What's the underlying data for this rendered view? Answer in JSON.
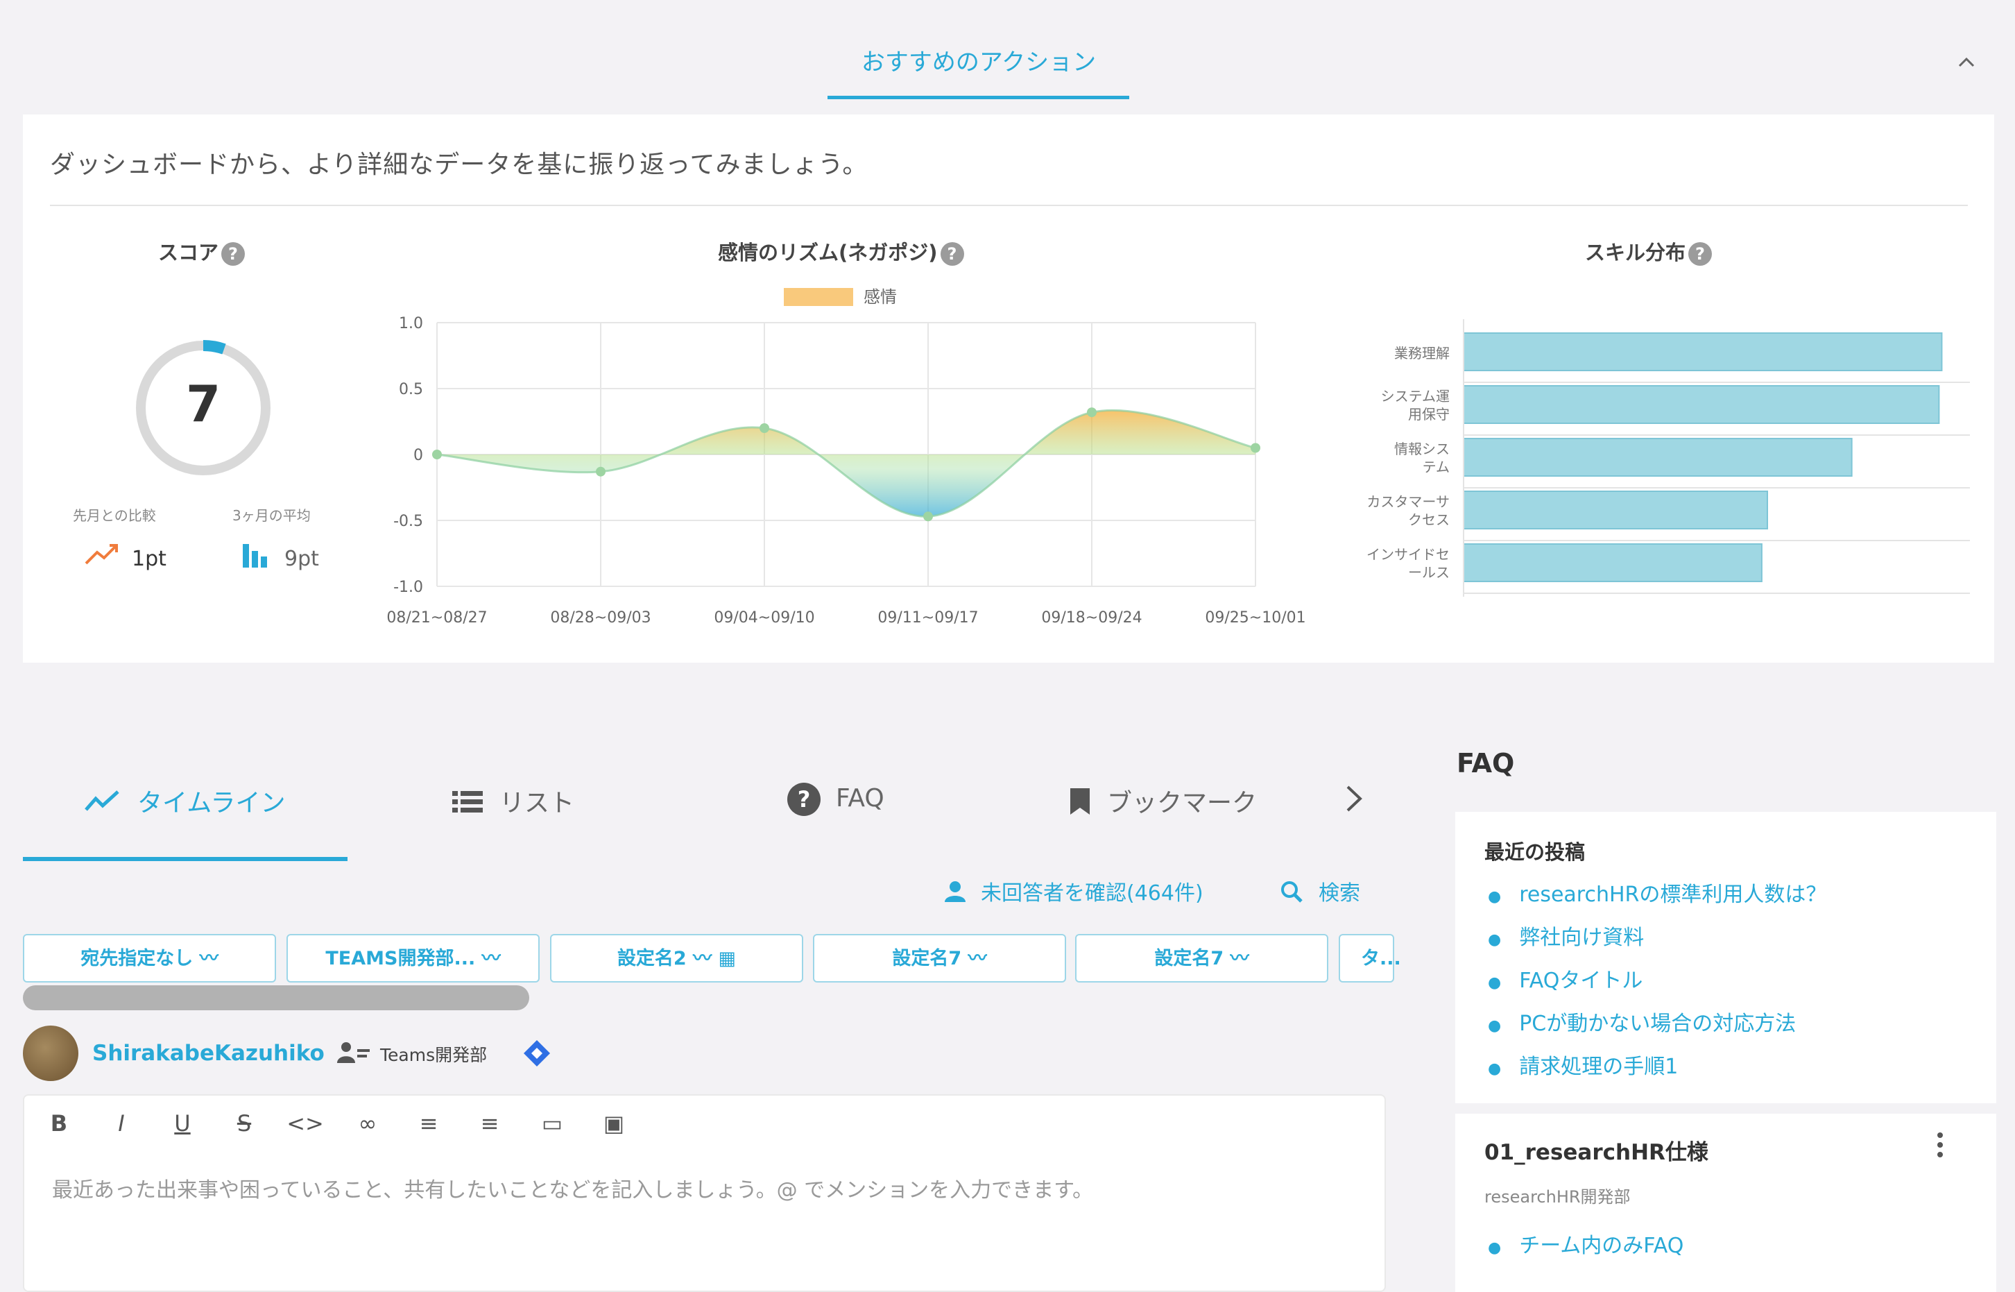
{
  "top_tab": {
    "label": "おすすめのアクション"
  },
  "collapse_icon": "chevron-up-icon",
  "dashboard": {
    "intro": "ダッシュボードから、より詳細なデータを基に振り返ってみましょう。",
    "score": {
      "title": "スコア",
      "value": "7",
      "prev_label": "先月との比較",
      "rank_label": "3ヶ月の平均",
      "prev_value": "1pt",
      "rank_value": "9pt",
      "ring_color": "#29a9d7"
    }
  },
  "rhythm_title": "感情のリズム(ネガポジ)",
  "skill_title": "スキル分布",
  "chart_data": [
    {
      "type": "area",
      "title": "感情のリズム(ネガポジ)",
      "legend": "top-center",
      "series": [
        {
          "name": "感情",
          "values": [
            0,
            -0.13,
            0.2,
            -0.47,
            0.32,
            0.05
          ]
        }
      ],
      "categories": [
        "08/21~08/27",
        "08/28~09/03",
        "09/04~09/10",
        "09/11~09/17",
        "09/18~09/24",
        "09/25~10/01"
      ],
      "ylim": [
        -1.0,
        1.0
      ],
      "y_ticks": [
        "1.0",
        "0.5",
        "0",
        "-0.5",
        "-1.0"
      ],
      "grid": true
    },
    {
      "type": "bar",
      "title": "スキル分布",
      "orientation": "horizontal",
      "categories": [
        "業務理解",
        "システム運用保守",
        "情報システム",
        "カスタマーサクセス",
        "インサイドセールス"
      ],
      "values": [
        3.4,
        3.38,
        2.76,
        2.16,
        2.12
      ],
      "color": "#9fd7e3",
      "grid": true
    }
  ],
  "tabs": {
    "timeline": "タイムライン",
    "list": "リスト",
    "faq": "FAQ",
    "bookmark": "ブックマーク"
  },
  "feed": {
    "unanswered": "未回答者を確認(464件)",
    "search": "検索",
    "chips": [
      "宛先指定なし",
      "TEAMS開発部...",
      "設定名2",
      "設定名7",
      "設定名7",
      "タ..."
    ],
    "user_name": "ShirakabeKazuhiko",
    "team_name": "Teams開発部",
    "placeholder": "最近あった出来事や困っていること、共有したいことなどを記入しましょう。@ でメンションを入力できます。",
    "toolbar": [
      "B",
      "I",
      "U",
      "S",
      "<>",
      "∞",
      "≡",
      "≡",
      "▭",
      "▣"
    ]
  },
  "faq": {
    "heading": "FAQ",
    "recent_title": "最近の投稿",
    "recent": [
      "researchHRの標準利用人数は？",
      "弊社向け資料",
      "FAQタイトル",
      "PCが動かない場合の対応方法",
      "請求処理の手順1"
    ],
    "category_title": "01_researchHR仕様",
    "category_dept": "researchHR開発部",
    "category_items": [
      "チーム内のみFAQ"
    ]
  }
}
